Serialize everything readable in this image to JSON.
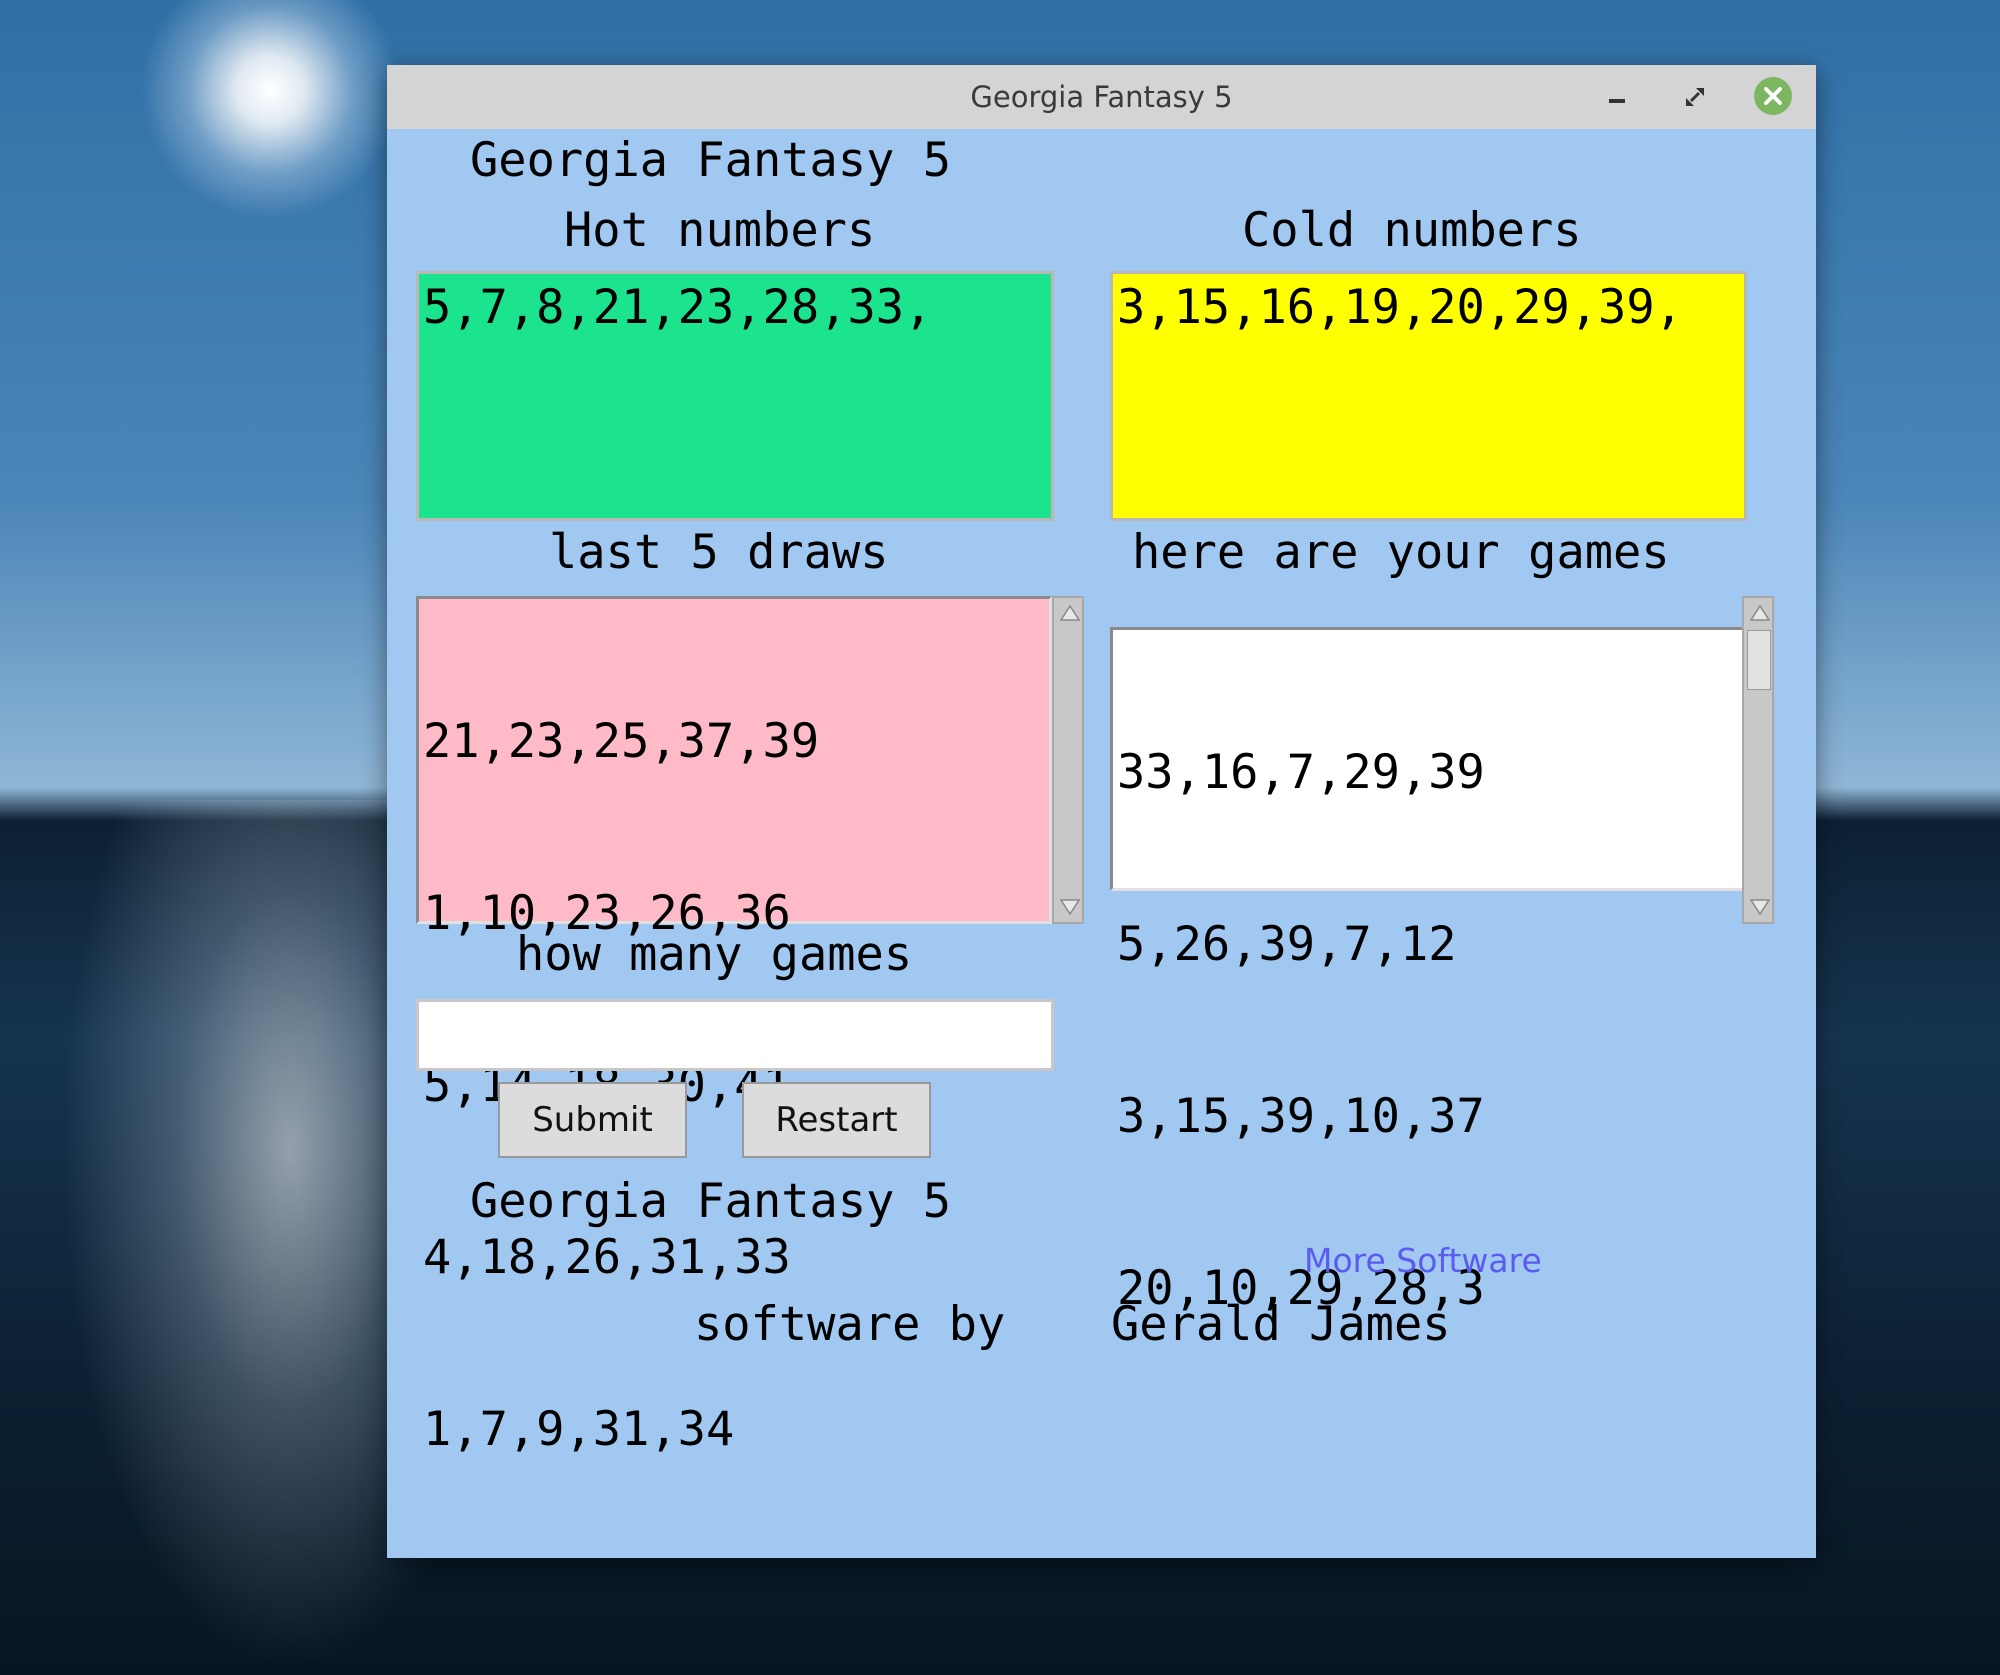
{
  "window": {
    "title": "Georgia Fantasy 5"
  },
  "app": {
    "heading": "Georgia Fantasy 5",
    "hot_label": "Hot numbers",
    "cold_label": "Cold numbers",
    "hot_numbers": "5,7,8,21,23,28,33,",
    "cold_numbers": "3,15,16,19,20,29,39,",
    "last_draws_label": "last 5 draws",
    "last_draws": [
      "21,23,25,37,39",
      "1,10,23,26,36",
      "5,14,18,30,41",
      "4,18,26,31,33",
      "1,7,9,31,34"
    ],
    "games_label": "here are your games",
    "games": [
      "33,16,7,29,39",
      "5,26,39,7,12",
      "3,15,39,10,37",
      "20,10,29,28,3"
    ],
    "how_many_label": "how many games",
    "how_many_value": "",
    "submit_label": "Submit",
    "restart_label": "Restart",
    "footer_heading": "Georgia Fantasy 5",
    "more_software_link": "More Software",
    "credit_prefix": "software by",
    "credit_name": "Gerald James"
  },
  "colors": {
    "window_bg": "#a0c8f0",
    "hot_bg": "#1ce38e",
    "cold_bg": "#ffff00",
    "draws_bg": "#ffbac7",
    "games_bg": "#ffffff",
    "link": "#5b5bf0"
  },
  "icons": {
    "minimize": "minimize-icon",
    "maximize": "maximize-icon",
    "close": "close-icon"
  }
}
